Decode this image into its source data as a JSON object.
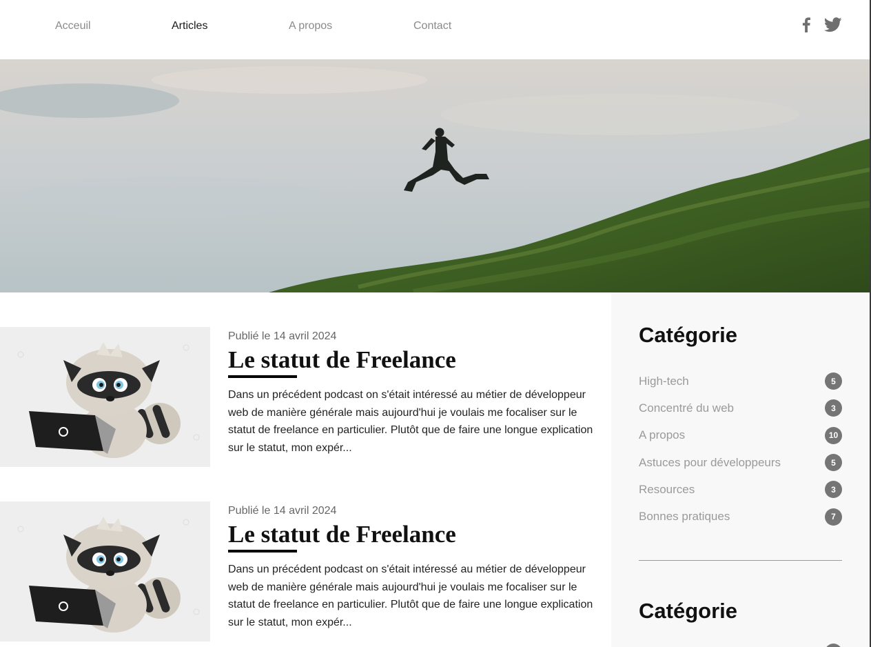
{
  "nav": {
    "items": [
      {
        "label": "Acceuil",
        "active": false
      },
      {
        "label": "Articles",
        "active": true
      },
      {
        "label": "A propos",
        "active": false
      },
      {
        "label": "Contact",
        "active": false
      }
    ]
  },
  "social": {
    "icons": [
      "facebook-icon",
      "twitter-icon"
    ]
  },
  "articles": [
    {
      "date": "Publié le 14 avril 2024",
      "title": "Le statut de Freelance",
      "excerpt": "Dans un précédent podcast on s'était intéressé au métier de développeur web de manière générale mais aujourd'hui je voulais me focaliser sur le statut de freelance en particulier. Plutôt que de faire une longue explication sur le statut, mon expér..."
    },
    {
      "date": "Publié le 14 avril 2024",
      "title": "Le statut de Freelance",
      "excerpt": "Dans un précédent podcast on s'était intéressé au métier de développeur web de manière générale mais aujourd'hui je voulais me focaliser sur le statut de freelance en particulier. Plutôt que de faire une longue explication sur le statut, mon expér..."
    }
  ],
  "sidebar": {
    "title": "Catégorie",
    "title2": "Catégorie",
    "categories": [
      {
        "label": "High-tech",
        "count": "5"
      },
      {
        "label": "Concentré du web",
        "count": "3"
      },
      {
        "label": "A propos",
        "count": "10"
      },
      {
        "label": "Astuces pour développeurs",
        "count": "5"
      },
      {
        "label": "Resources",
        "count": "3"
      },
      {
        "label": "Bonnes pratiques",
        "count": "7"
      }
    ]
  },
  "colors": {
    "badge": "#757575",
    "nav_inactive": "#8a8a8a",
    "nav_active": "#1a1a1a",
    "sidebar_bg": "#f8f8f8"
  }
}
